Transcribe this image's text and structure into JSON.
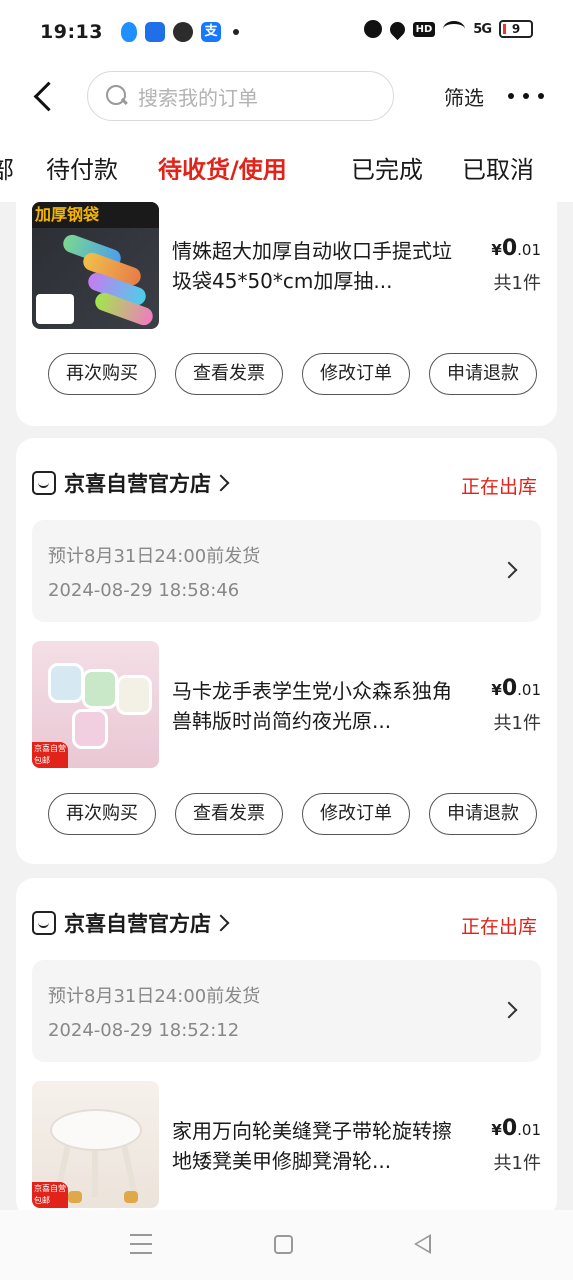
{
  "status_bar": {
    "time": "19:13",
    "hd": "HD",
    "network": "5G",
    "battery": "9"
  },
  "header": {
    "search_placeholder": "搜索我的订单",
    "filter_label": "筛选"
  },
  "tabs": [
    {
      "label": "部"
    },
    {
      "label": "待付款"
    },
    {
      "label": "待收货/使用",
      "active": true
    },
    {
      "label": "已完成"
    },
    {
      "label": "已取消"
    }
  ],
  "orders": [
    {
      "product_title": "情姝超大加厚自动收口手提式垃圾袋45*50*cm加厚抽...",
      "price_symbol": "¥",
      "price_int": "0",
      "price_dec": ".01",
      "quantity": "共1件",
      "image_text": "加厚钢袋",
      "actions": [
        "再次购买",
        "查看发票",
        "修改订单",
        "申请退款"
      ]
    },
    {
      "store_name": "京喜自营官方店",
      "status": "正在出库",
      "ship_estimate": "预计8月31日24:00前发货",
      "ship_time": "2024-08-29 18:58:46",
      "product_title": "马卡龙手表学生党小众森系独角兽韩版时尚简约夜光原...",
      "price_symbol": "¥",
      "price_int": "0",
      "price_dec": ".01",
      "quantity": "共1件",
      "image_tag": "京喜自营 包邮",
      "actions": [
        "再次购买",
        "查看发票",
        "修改订单",
        "申请退款"
      ]
    },
    {
      "store_name": "京喜自营官方店",
      "status": "正在出库",
      "ship_estimate": "预计8月31日24:00前发货",
      "ship_time": "2024-08-29 18:52:12",
      "product_title": "家用万向轮美缝凳子带轮旋转擦地矮凳美甲修脚凳滑轮...",
      "price_symbol": "¥",
      "price_int": "0",
      "price_dec": ".01",
      "quantity": "共1件",
      "image_tag": "京喜自营 包邮"
    }
  ],
  "icons": {
    "back": "back-chevron-icon",
    "search": "search-icon",
    "more": "more-dots-icon",
    "store": "store-icon",
    "nav_menu": "menu-icon",
    "nav_home": "home-square-icon",
    "nav_back": "back-triangle-icon"
  },
  "colors": {
    "accent": "#e2231a",
    "background": "#f2f2f2",
    "card": "#ffffff"
  }
}
